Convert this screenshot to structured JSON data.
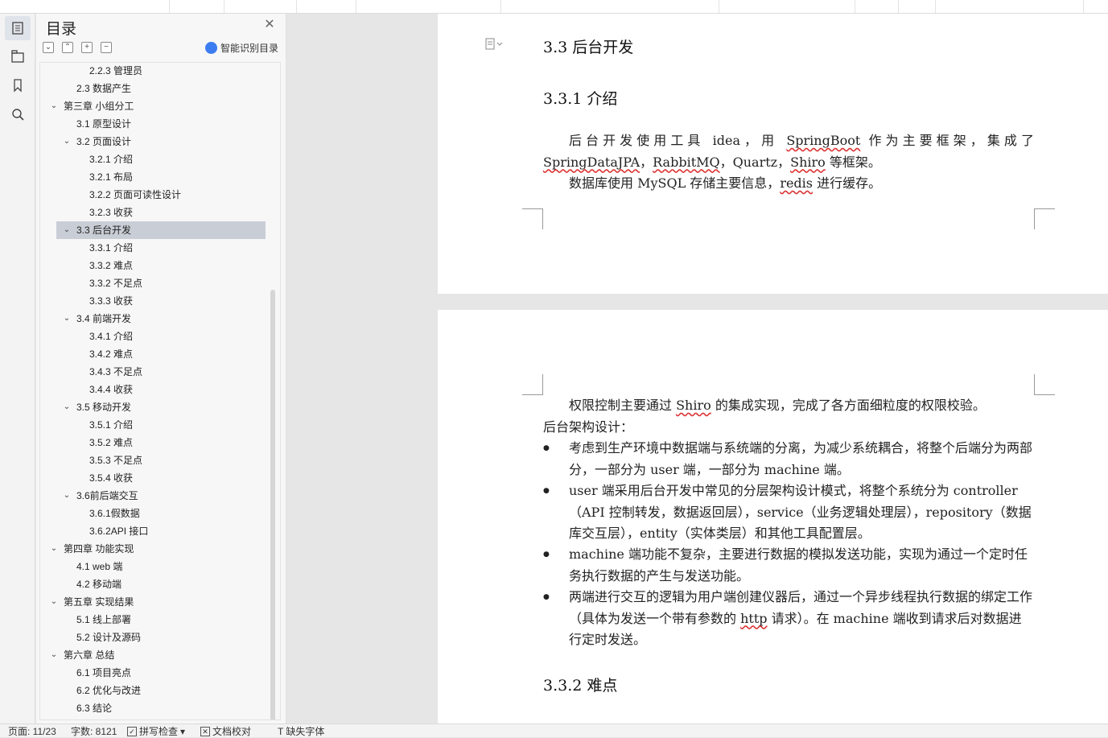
{
  "toc": {
    "title": "目录",
    "smart_label": "智能识别目录",
    "items": [
      {
        "label": "2.2.3  管理员",
        "level": 3,
        "arrow": ""
      },
      {
        "label": "2.3  数据产生",
        "level": 2,
        "arrow": ""
      },
      {
        "label": "第三章  小组分工",
        "level": 1,
        "arrow": "v"
      },
      {
        "label": "3.1  原型设计",
        "level": 2,
        "arrow": ""
      },
      {
        "label": "3.2  页面设计",
        "level": 2,
        "arrow": "v"
      },
      {
        "label": "3.2.1  介绍",
        "level": 3,
        "arrow": ""
      },
      {
        "label": "3.2.1  布局",
        "level": 3,
        "arrow": ""
      },
      {
        "label": "3.2.2  页面可读性设计",
        "level": 3,
        "arrow": ""
      },
      {
        "label": "3.2.3  收获",
        "level": 3,
        "arrow": ""
      },
      {
        "label": "3.3  后台开发",
        "level": 2,
        "arrow": "v",
        "selected": true
      },
      {
        "label": "3.3.1  介绍",
        "level": 3,
        "arrow": ""
      },
      {
        "label": "3.3.2  难点",
        "level": 3,
        "arrow": ""
      },
      {
        "label": "3.3.2  不足点",
        "level": 3,
        "arrow": ""
      },
      {
        "label": "3.3.3  收获",
        "level": 3,
        "arrow": ""
      },
      {
        "label": "3.4  前端开发",
        "level": 2,
        "arrow": "v"
      },
      {
        "label": "3.4.1  介绍",
        "level": 3,
        "arrow": ""
      },
      {
        "label": "3.4.2  难点",
        "level": 3,
        "arrow": ""
      },
      {
        "label": "3.4.3  不足点",
        "level": 3,
        "arrow": ""
      },
      {
        "label": "3.4.4  收获",
        "level": 3,
        "arrow": ""
      },
      {
        "label": "3.5  移动开发",
        "level": 2,
        "arrow": "v"
      },
      {
        "label": "3.5.1  介绍",
        "level": 3,
        "arrow": ""
      },
      {
        "label": "3.5.2  难点",
        "level": 3,
        "arrow": ""
      },
      {
        "label": "3.5.3  不足点",
        "level": 3,
        "arrow": ""
      },
      {
        "label": "3.5.4  收获",
        "level": 3,
        "arrow": ""
      },
      {
        "label": "3.6前后端交互",
        "level": 2,
        "arrow": "v"
      },
      {
        "label": "3.6.1假数据",
        "level": 3,
        "arrow": ""
      },
      {
        "label": "3.6.2API 接口",
        "level": 3,
        "arrow": ""
      },
      {
        "label": "第四章  功能实现",
        "level": 1,
        "arrow": "v"
      },
      {
        "label": "4.1 web 端",
        "level": 2,
        "arrow": ""
      },
      {
        "label": "4.2  移动端",
        "level": 2,
        "arrow": ""
      },
      {
        "label": "第五章  实现结果",
        "level": 1,
        "arrow": "v"
      },
      {
        "label": "5.1  线上部署",
        "level": 2,
        "arrow": ""
      },
      {
        "label": "5.2  设计及源码",
        "level": 2,
        "arrow": ""
      },
      {
        "label": "第六章  总结",
        "level": 1,
        "arrow": "v"
      },
      {
        "label": "6.1  项目亮点",
        "level": 2,
        "arrow": ""
      },
      {
        "label": "6.2  优化与改进",
        "level": 2,
        "arrow": ""
      },
      {
        "label": "6.3  结论",
        "level": 2,
        "arrow": ""
      }
    ]
  },
  "doc": {
    "h_33": "3.3  后台开发",
    "h_331": "3.3.1  介绍",
    "p1_a": "后台开发使用工具 idea，用 ",
    "p1_springboot": "SpringBoot",
    "p1_b": " 作为主要框架，集成了 ",
    "p1_jpa": "SpringDataJPA",
    "p1_c": "，",
    "p1_mq": "RabbitMQ",
    "p1_d": "，Quartz，",
    "p1_shiro": "Shiro",
    "p1_e": " 等框架。",
    "p2_a": "数据库使用 MySQL 存储主要信息，",
    "p2_redis": "redis",
    "p2_b": " 进行缓存。",
    "p3_a": "权限控制主要通过 ",
    "p3_shiro": "Shiro",
    "p3_b": " 的集成实现，完成了各方面细粒度的权限校验。",
    "p4": "后台架构设计：",
    "b1": "考虑到生产环境中数据端与系统端的分离，为减少系统耦合，将整个后端分为两部分，一部分为 user 端，一部分为 machine 端。",
    "b2": "user 端采用后台开发中常见的分层架构设计模式，将整个系统分为 controller（API 控制转发，数据返回层），service（业务逻辑处理层），repository（数据库交互层），entity（实体类层）和其他工具配置层。",
    "b3": "machine 端功能不复杂，主要进行数据的模拟发送功能，实现为通过一个定时任务执行数据的产生与发送功能。",
    "b4_a": "两端进行交互的逻辑为用户端创建仪器后，通过一个异步线程执行数据的绑定工作（具体为发送一个带有参数的 ",
    "b4_http": "http",
    "b4_b": " 请求）。在 machine 端收到请求后对数据进行定时发送。",
    "h_332": "3.3.2  难点"
  },
  "status": {
    "page": "页面: 11/23",
    "words": "字数: 8121",
    "spell": "拼写检查",
    "proof": "文档校对",
    "font": "缺失字体"
  }
}
